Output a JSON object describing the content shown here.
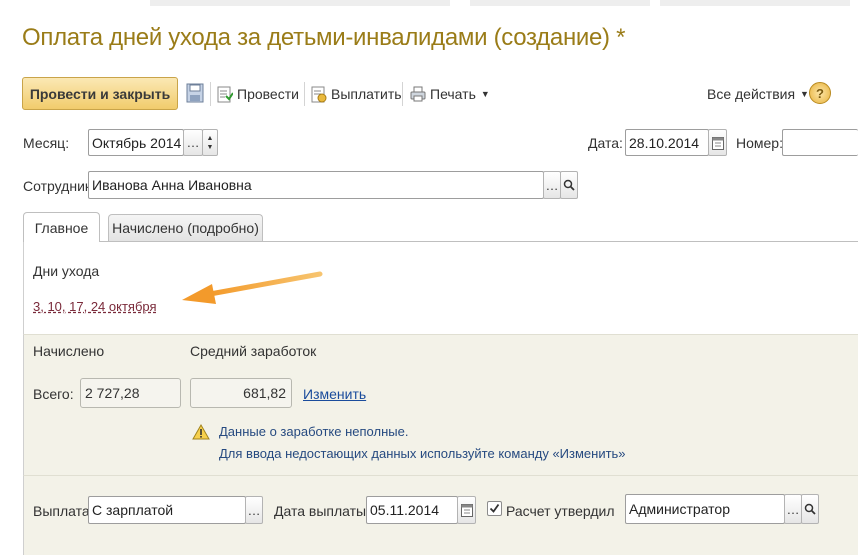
{
  "window": {
    "title": "Оплата дней ухода за детьми-инвалидами (создание) *"
  },
  "toolbar": {
    "post_close": "Провести и закрыть",
    "post": "Провести",
    "pay": "Выплатить",
    "print": "Печать",
    "all_actions": "Все действия",
    "help": "?"
  },
  "header": {
    "month_label": "Месяц:",
    "month_value": "Октябрь 2014",
    "date_label": "Дата:",
    "date_value": "28.10.2014",
    "number_label": "Номер:",
    "number_value": "",
    "employee_label": "Сотрудник:",
    "employee_value": "Иванова Анна Ивановна"
  },
  "tabs": [
    {
      "label": "Главное",
      "active": true
    },
    {
      "label": "Начислено (подробно)",
      "active": false
    }
  ],
  "main": {
    "care_days_label": "Дни ухода",
    "care_days_link": "3, 10, 17, 24 октября",
    "accrued_label": "Начислено",
    "avg_earnings_label": "Средний заработок",
    "total_label": "Всего:",
    "total_value": "2 727,28",
    "avg_value": "681,82",
    "change_link": "Изменить",
    "warning_line1": "Данные о заработке неполные.",
    "warning_line2": "Для ввода недостающих данных используйте команду «Изменить»"
  },
  "footer": {
    "payout_label": "Выплата:",
    "payout_value": "С зарплатой",
    "payout_date_label": "Дата выплаты:",
    "payout_date_value": "05.11.2014",
    "approved_label": "Расчет утвердил",
    "approved_checked": true,
    "approver_value": "Администратор"
  },
  "colors": {
    "title": "#9a7c18",
    "primary_button": "#f1cc6c",
    "arrow": "#f39a2b",
    "link": "#1a4c9c",
    "panel": "#f3f2e8"
  }
}
